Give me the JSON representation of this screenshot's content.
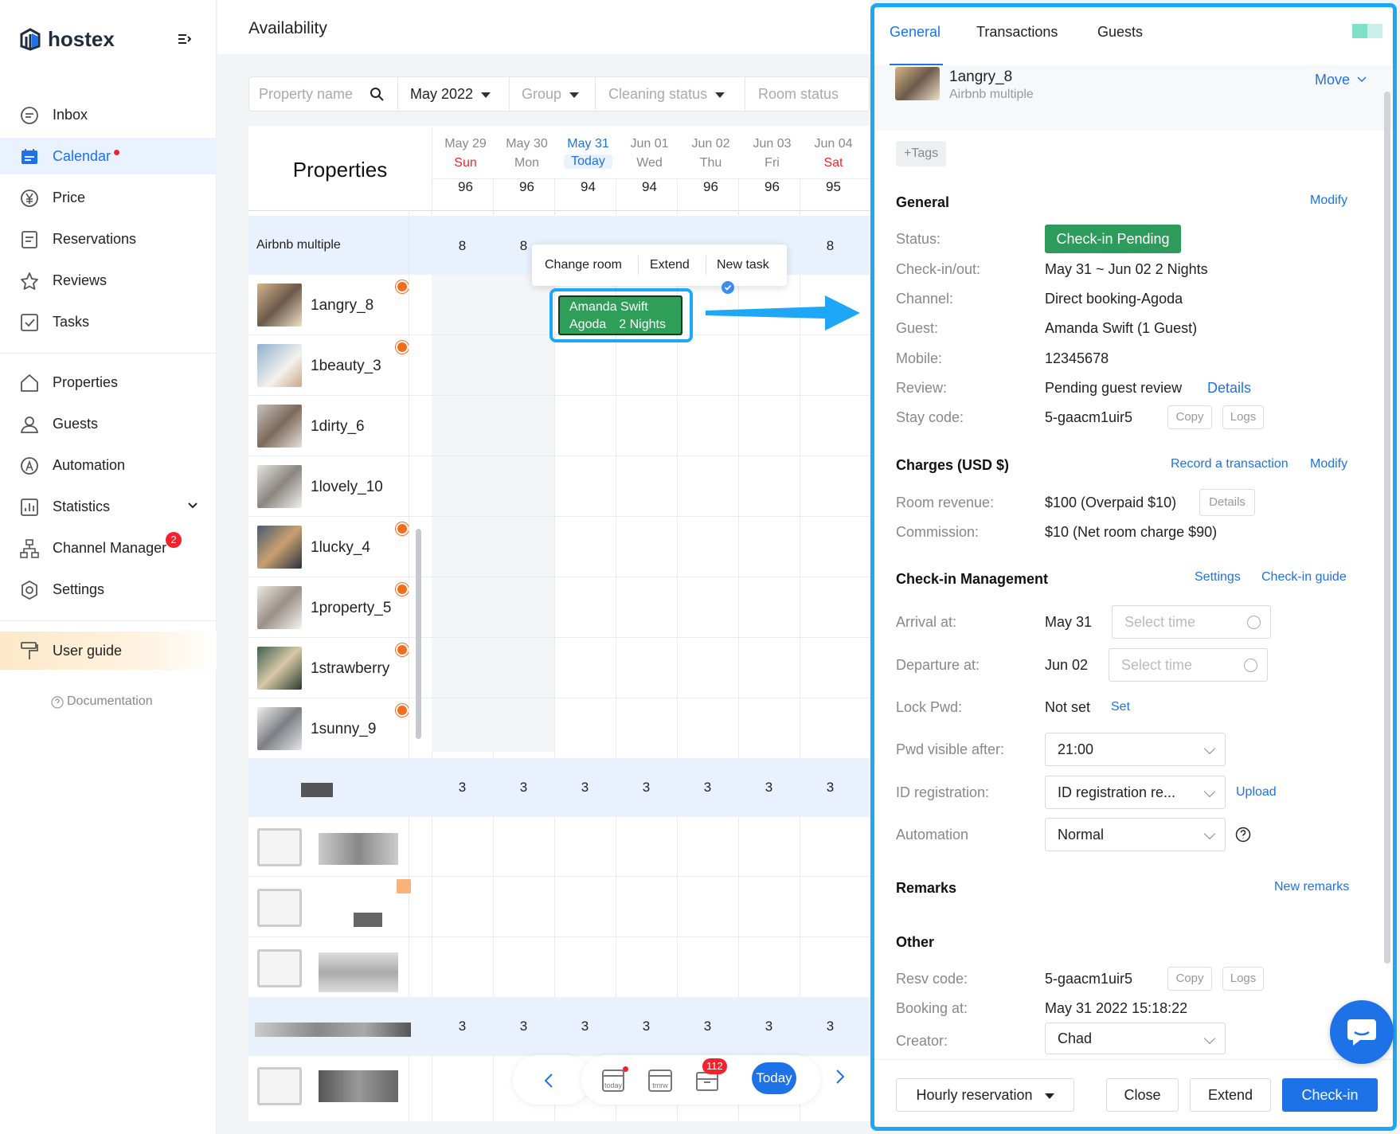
{
  "app": {
    "name": "hostex"
  },
  "sidebar": {
    "items": [
      {
        "label": "Inbox",
        "icon": "inbox-icon"
      },
      {
        "label": "Calendar",
        "icon": "calendar-icon"
      },
      {
        "label": "Price",
        "icon": "yen-icon"
      },
      {
        "label": "Reservations",
        "icon": "reservations-icon"
      },
      {
        "label": "Reviews",
        "icon": "star-icon"
      },
      {
        "label": "Tasks",
        "icon": "checkbox-icon"
      },
      {
        "label": "Properties",
        "icon": "home-icon"
      },
      {
        "label": "Guests",
        "icon": "user-icon"
      },
      {
        "label": "Automation",
        "icon": "automation-icon"
      },
      {
        "label": "Statistics",
        "icon": "chart-icon"
      },
      {
        "label": "Channel Manager",
        "icon": "sitemap-icon"
      },
      {
        "label": "Settings",
        "icon": "gear-icon"
      }
    ],
    "channel_manager_badge": "2",
    "user_guide": "User guide",
    "documentation": "Documentation"
  },
  "page": {
    "title": "Availability"
  },
  "filters": {
    "property_placeholder": "Property name",
    "month": "May 2022",
    "group": "Group",
    "cleaning": "Cleaning status",
    "room": "Room status"
  },
  "grid": {
    "properties_header": "Properties",
    "days": [
      {
        "date": "May 29",
        "dow": "Sun",
        "count": "96"
      },
      {
        "date": "May 30",
        "dow": "Mon",
        "count": "96"
      },
      {
        "date": "May 31",
        "dow": "Today",
        "count": "94"
      },
      {
        "date": "Jun 01",
        "dow": "Wed",
        "count": "94"
      },
      {
        "date": "Jun 02",
        "dow": "Thu",
        "count": "96"
      },
      {
        "date": "Jun 03",
        "dow": "Fri",
        "count": "96"
      },
      {
        "date": "Jun 04",
        "dow": "Sat",
        "count": "95"
      }
    ],
    "group_name": "Airbnb multiple",
    "group_counts": [
      "8",
      "8",
      "",
      "",
      "",
      "",
      "8"
    ],
    "properties": [
      "1angry_8",
      "1beauty_3",
      "1dirty_6",
      "1lovely_10",
      "1lucky_4",
      "1property_5",
      "1strawberry",
      "1sunny_9"
    ],
    "group2_counts": [
      "3",
      "3",
      "3",
      "3",
      "3",
      "3",
      "3"
    ],
    "group3_counts": [
      "3",
      "3",
      "3",
      "3",
      "3",
      "3",
      "3"
    ]
  },
  "context_menu": {
    "change_room": "Change room",
    "extend": "Extend",
    "new_task": "New task"
  },
  "booking": {
    "guest": "Amanda Swift",
    "channel": "Agoda",
    "nights": "2 Nights"
  },
  "bottom_nav": {
    "today_icon": "today",
    "tmrw_icon": "tmrw",
    "inbox_badge": "112",
    "today": "Today"
  },
  "drawer": {
    "tabs": [
      "General",
      "Transactions",
      "Guests"
    ],
    "property": {
      "name": "1angry_8",
      "group": "Airbnb multiple",
      "move": "Move"
    },
    "tags": "+Tags",
    "general": {
      "title": "General",
      "modify": "Modify",
      "status_label": "Status:",
      "status": "Check-in Pending",
      "checkinout_label": "Check-in/out:",
      "checkinout": "May 31 ~ Jun 02 2 Nights",
      "channel_label": "Channel:",
      "channel": "Direct booking-Agoda",
      "guest_label": "Guest:",
      "guest": "Amanda Swift (1 Guest)",
      "mobile_label": "Mobile:",
      "mobile": "12345678",
      "review_label": "Review:",
      "review": "Pending guest review",
      "review_details": "Details",
      "stay_code_label": "Stay code:",
      "stay_code": "5-gaacm1uir5",
      "copy": "Copy",
      "logs": "Logs"
    },
    "charges": {
      "title": "Charges (USD $)",
      "record": "Record a transaction",
      "modify": "Modify",
      "room_revenue_label": "Room revenue:",
      "room_revenue": "$100 (Overpaid $10)",
      "details": "Details",
      "commission_label": "Commission:",
      "commission": "$10 (Net room charge  $90)"
    },
    "checkin": {
      "title": "Check-in Management",
      "settings": "Settings",
      "guide": "Check-in guide",
      "arrival_label": "Arrival at:",
      "arrival": "May 31",
      "arrival_placeholder": "Select time",
      "departure_label": "Departure at:",
      "departure": "Jun 02",
      "departure_placeholder": "Select time",
      "lock_label": "Lock Pwd:",
      "lock": "Not set",
      "lock_set": "Set",
      "pwd_label": "Pwd visible after:",
      "pwd": "21:00",
      "id_label": "ID registration:",
      "id": "ID registration re...",
      "upload": "Upload",
      "automation_label": "Automation",
      "automation": "Normal"
    },
    "remarks": {
      "title": "Remarks",
      "new": "New remarks"
    },
    "other": {
      "title": "Other",
      "resv_label": "Resv code:",
      "resv": "5-gaacm1uir5",
      "copy": "Copy",
      "logs": "Logs",
      "booking_label": "Booking at:",
      "booking": "May 31 2022 15:18:22",
      "creator_label": "Creator:",
      "creator": "Chad"
    },
    "footer": {
      "hourly": "Hourly reservation",
      "close": "Close",
      "extend": "Extend",
      "checkin": "Check-in"
    }
  },
  "colors": {
    "accent": "#1d72e8",
    "status_green": "#2d9b5b",
    "highlight": "#1ea7f6",
    "badge": "#f5222d"
  }
}
